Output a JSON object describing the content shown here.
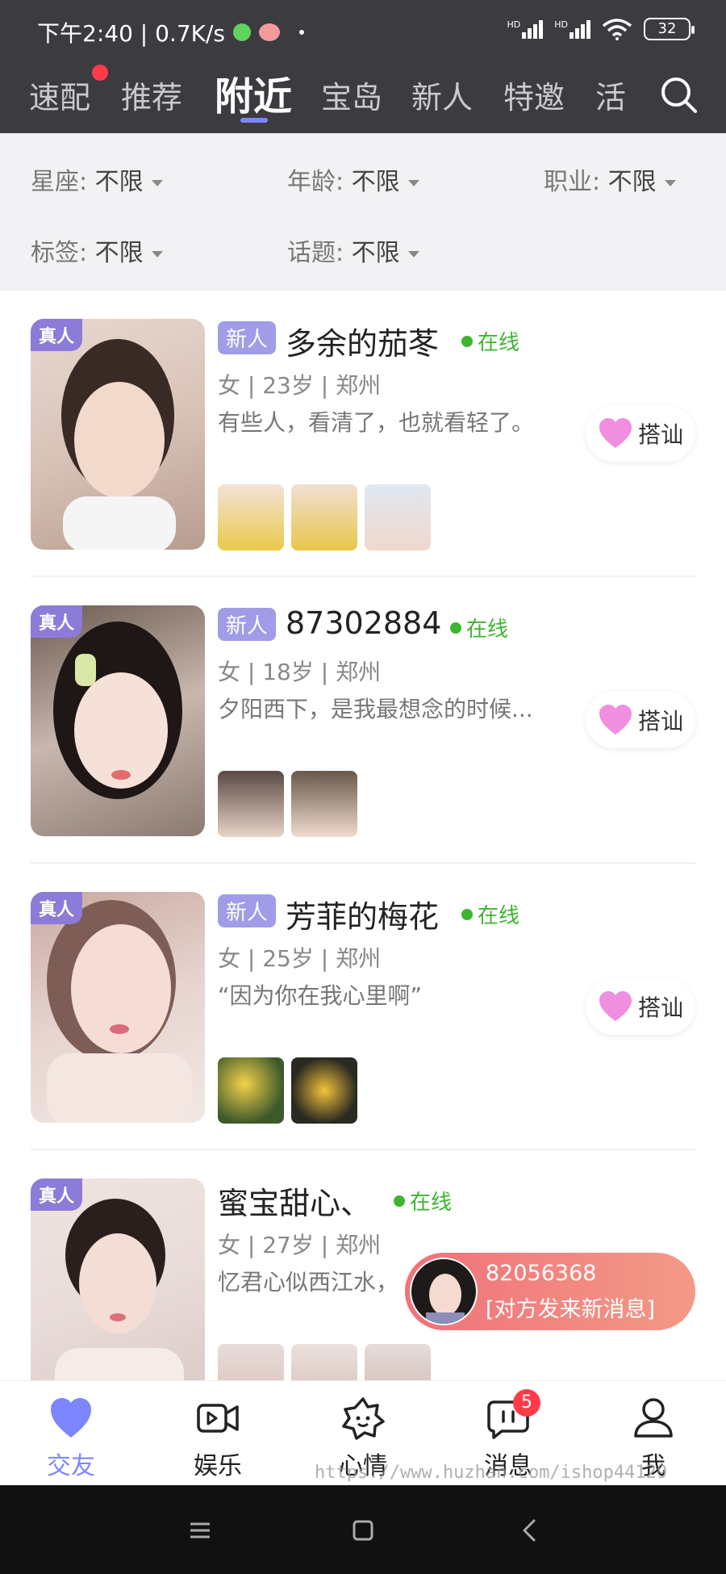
{
  "status_bar": {
    "time_speed": "下午2:40 | 0.7K/s",
    "battery": "32",
    "signal1": "HD",
    "signal2": "HD"
  },
  "top_nav": {
    "tabs": [
      "速配",
      "推荐",
      "附近",
      "宝岛",
      "新人",
      "特邀",
      "活"
    ],
    "active": "附近"
  },
  "filters": {
    "constellation": {
      "label": "星座:",
      "value": "不限"
    },
    "age": {
      "label": "年龄:",
      "value": "不限"
    },
    "job": {
      "label": "职业:",
      "value": "不限"
    },
    "tag": {
      "label": "标签:",
      "value": "不限"
    },
    "topic": {
      "label": "话题:",
      "value": "不限"
    }
  },
  "labels": {
    "real": "真人",
    "new": "新人",
    "online": "在线",
    "flirt": "搭讪"
  },
  "users": [
    {
      "name": "多余的茄苳",
      "is_new": true,
      "meta": "女 | 23岁 | 郑州",
      "bio": "有些人，看清了，也就看轻了。",
      "photo_count": 3,
      "tone": "#d9c3b8"
    },
    {
      "name": "87302884",
      "is_new": true,
      "meta": "女 | 18岁 | 郑州",
      "bio": "夕阳西下，是我最想念的时候...",
      "photo_count": 2,
      "tone": "#c8b7ae"
    },
    {
      "name": "芳菲的梅花",
      "is_new": true,
      "meta": "女 | 25岁 | 郑州",
      "bio": "“因为你在我心里啊”",
      "photo_count": 2,
      "tone": "#e6d4cf"
    },
    {
      "name": "蜜宝甜心、",
      "is_new": false,
      "meta": "女 | 27岁 | 郑州",
      "bio": "忆君心似西江水，",
      "photo_count": 3,
      "tone": "#e9dcd8"
    }
  ],
  "message_popup": {
    "sender_id": "82056368",
    "text": "[对方发来新消息]"
  },
  "bottom_tabs": [
    {
      "label": "交友",
      "icon": "heart-icon",
      "active": true
    },
    {
      "label": "娱乐",
      "icon": "video-icon",
      "active": false
    },
    {
      "label": "心情",
      "icon": "mood-icon",
      "active": false
    },
    {
      "label": "消息",
      "icon": "chat-icon",
      "active": false,
      "badge": "5"
    },
    {
      "label": "我",
      "icon": "user-icon",
      "active": false
    }
  ],
  "watermark": "https://www.huzhan.com/ishop44129",
  "colors": {
    "accent": "#7d86ff",
    "online": "#3db52f",
    "topbar": "#3b3b40",
    "badge": "#ff3b4a"
  }
}
